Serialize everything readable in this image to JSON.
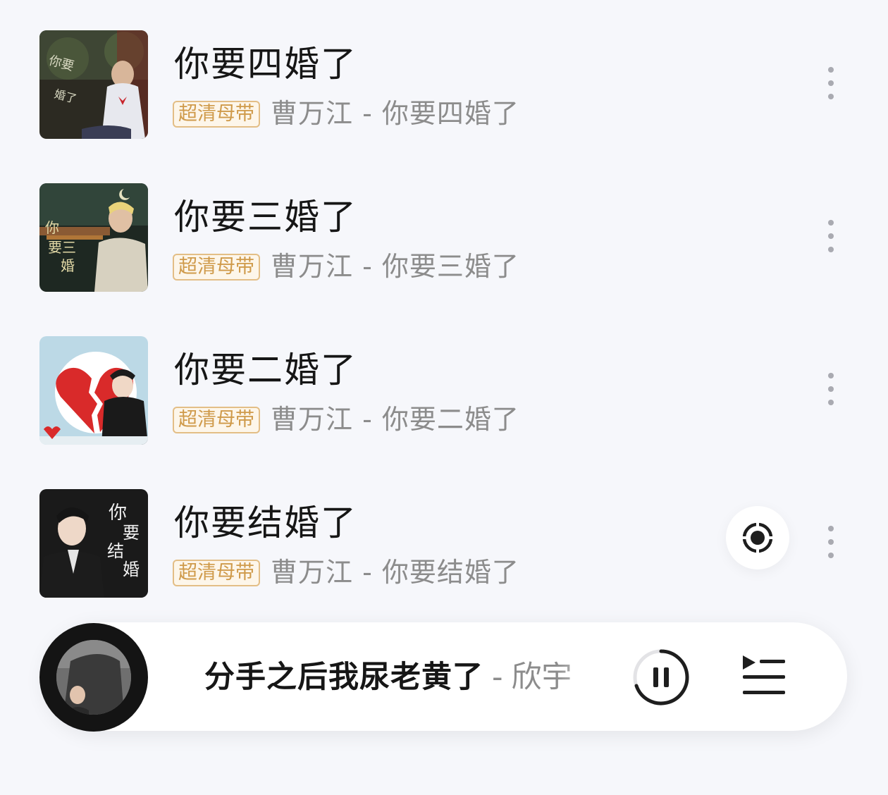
{
  "songs": [
    {
      "title": "你要四婚了",
      "badge": "超清母带",
      "subtitle": "曹万江 - 你要四婚了",
      "cover": "cover-4",
      "icon": "more-icon"
    },
    {
      "title": "你要三婚了",
      "badge": "超清母带",
      "subtitle": "曹万江 - 你要三婚了",
      "cover": "cover-3",
      "icon": "more-icon"
    },
    {
      "title": "你要二婚了",
      "badge": "超清母带",
      "subtitle": "曹万江 - 你要二婚了",
      "cover": "cover-2",
      "icon": "more-icon"
    },
    {
      "title": "你要结婚了",
      "badge": "超清母带",
      "subtitle": "曹万江 - 你要结婚了",
      "cover": "cover-1",
      "icon": "more-icon"
    }
  ],
  "locate_icon": "locate-current-icon",
  "player": {
    "title": "分手之后我尿老黄了",
    "separator": "-",
    "artist": "欣宇",
    "pause_icon": "pause-icon",
    "playlist_icon": "playlist-icon"
  },
  "colors": {
    "background": "#f6f7fb",
    "badge_gold": "#cf9a4a",
    "title": "#161616",
    "subtitle": "#8c8c8c"
  }
}
